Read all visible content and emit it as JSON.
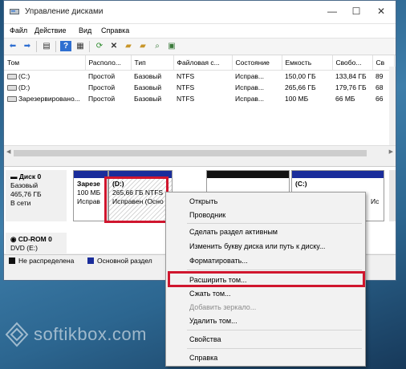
{
  "window": {
    "title": "Управление дисками",
    "controls": {
      "minimize": "—",
      "maximize": "☐",
      "close": "✕"
    }
  },
  "menu": [
    "Файл",
    "Действие",
    "Вид",
    "Справка"
  ],
  "toolbar_icons": [
    "back-icon",
    "forward-icon",
    "console-icon",
    "help-icon",
    "properties-icon",
    "refresh-icon",
    "delete-icon",
    "folder-open-icon",
    "folder-icon",
    "search-icon",
    "view-icon"
  ],
  "volumes": {
    "columns": [
      "Том",
      "Располо...",
      "Тип",
      "Файловая с...",
      "Состояние",
      "Емкость",
      "Свобо...",
      "Св"
    ],
    "rows": [
      [
        "(C:)",
        "Простой",
        "Базовый",
        "NTFS",
        "Исправ...",
        "150,00 ГБ",
        "133,84 ГБ",
        "89"
      ],
      [
        "(D:)",
        "Простой",
        "Базовый",
        "NTFS",
        "Исправ...",
        "265,66 ГБ",
        "179,76 ГБ",
        "68"
      ],
      [
        "Зарезервировано...",
        "Простой",
        "Базовый",
        "NTFS",
        "Исправ...",
        "100 МБ",
        "66 МБ",
        "66"
      ]
    ]
  },
  "disk0": {
    "name": "Диск 0",
    "type": "Базовый",
    "size": "465,76 ГБ",
    "status": "В сети",
    "partitions": {
      "reserved": {
        "name": "Зарезе",
        "size": "100 МБ",
        "status": "Исправ"
      },
      "d": {
        "name": "(D:)",
        "size": "265,66 ГБ NTFS",
        "status": "Исправен (Осно"
      },
      "c": {
        "name": "(C:)",
        "status": "Ис"
      }
    }
  },
  "cdrom": {
    "name": "CD-ROM 0",
    "drive": "DVD (E:)"
  },
  "legend": [
    {
      "label": "Не распределена",
      "color": "#111111"
    },
    {
      "label": "Основной раздел",
      "color": "#1a2d9b"
    }
  ],
  "context_menu": {
    "items": [
      {
        "label": "Открыть",
        "enabled": true
      },
      {
        "label": "Проводник",
        "enabled": true
      },
      {
        "label": "Сделать раздел активным",
        "enabled": true
      },
      {
        "label": "Изменить букву диска или путь к диску...",
        "enabled": true
      },
      {
        "label": "Форматировать...",
        "enabled": true
      },
      {
        "label": "Расширить том...",
        "enabled": true
      },
      {
        "label": "Сжать том...",
        "enabled": true
      },
      {
        "label": "Добавить зеркало...",
        "enabled": false
      },
      {
        "label": "Удалить том...",
        "enabled": true
      },
      {
        "label": "Свойства",
        "enabled": true
      },
      {
        "label": "Справка",
        "enabled": true
      }
    ]
  },
  "watermark": "softikbox.com",
  "colors": {
    "highlight": "#d0162e",
    "primary_partition": "#1a2d9b",
    "unallocated": "#111111"
  }
}
